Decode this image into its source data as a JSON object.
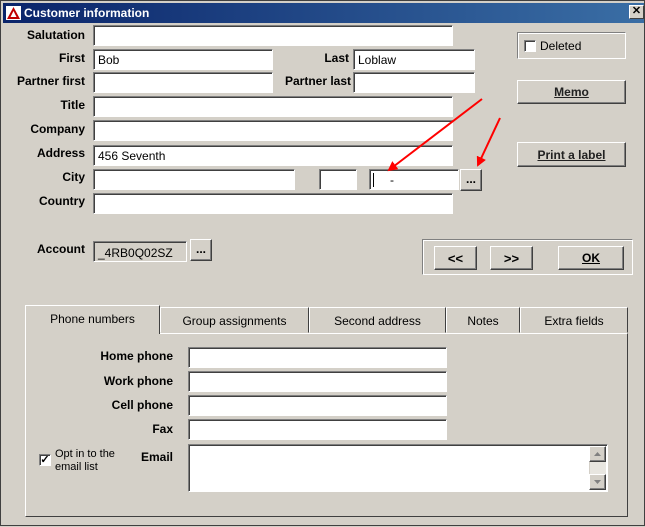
{
  "window": {
    "title": "Customer information",
    "close_glyph": "✕"
  },
  "labels": {
    "salutation": "Salutation",
    "first": "First",
    "last": "Last",
    "partner_first": "Partner first",
    "partner_last": "Partner last",
    "title": "Title",
    "company": "Company",
    "address": "Address",
    "city": "City",
    "country": "Country",
    "account": "Account"
  },
  "fields": {
    "salutation": "",
    "first": "Bob",
    "last": "Loblaw",
    "partner_first": "",
    "partner_last": "",
    "title": "",
    "company": "",
    "address": "456 Seventh",
    "city": "",
    "state": "",
    "zip": "-",
    "country": "",
    "account": "_4RB0Q02SZ"
  },
  "buttons": {
    "zip_lookup": "...",
    "account_lookup": "...",
    "memo": "Memo",
    "print_label": "Print a label",
    "prev": "<<",
    "next": ">>",
    "ok": "OK"
  },
  "deleted": {
    "label": "Deleted",
    "checked": false
  },
  "tabs": [
    {
      "label": "Phone numbers",
      "active": true
    },
    {
      "label": "Group assignments",
      "active": false
    },
    {
      "label": "Second address",
      "active": false
    },
    {
      "label": "Notes",
      "active": false
    },
    {
      "label": "Extra fields",
      "active": false
    }
  ],
  "phone": {
    "home_label": "Home phone",
    "work_label": "Work phone",
    "cell_label": "Cell phone",
    "fax_label": "Fax",
    "email_label": "Email",
    "home": "",
    "work": "",
    "cell": "",
    "fax": "",
    "email": "",
    "opt_in_label": "Opt in to the email list",
    "opt_in_checked": true
  },
  "colors": {
    "title_start": "#0a246a",
    "title_end": "#3a6ea5",
    "arrow": "#ff0000",
    "nav_text": "#003a8c",
    "ok_text": "#006400"
  },
  "icons": {
    "app": "app-icon",
    "close": "close-icon",
    "scroll_up": "scroll-up-icon",
    "scroll_down": "scroll-down-icon",
    "annotation_arrows": "red-arrow-icon"
  }
}
